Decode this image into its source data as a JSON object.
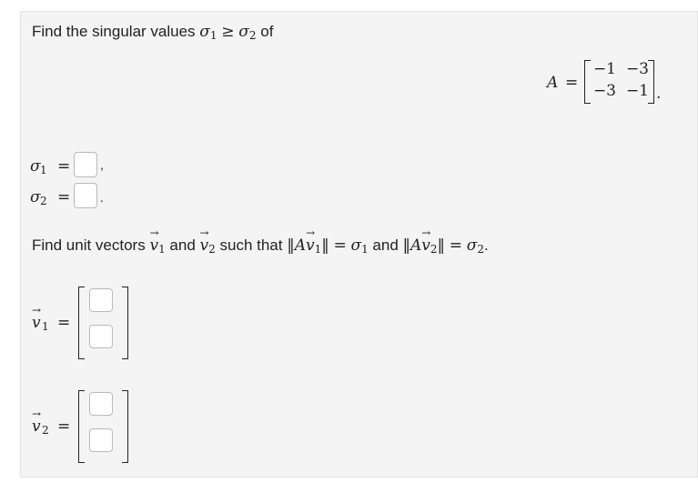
{
  "prompt_line1": {
    "text_before": "Find the singular values ",
    "sigma": "σ",
    "sub1": "1",
    "geq": "≥",
    "sub2": "2",
    "text_after": "of"
  },
  "matrix": {
    "name": "A",
    "equals": "=",
    "entries": [
      [
        "−1",
        "−3"
      ],
      [
        "−3",
        "−1"
      ]
    ],
    "trailing": "."
  },
  "sigma_answers": [
    {
      "symbol": "σ",
      "sub": "1",
      "equals": "=",
      "value": "",
      "trailing": ","
    },
    {
      "symbol": "σ",
      "sub": "2",
      "equals": "=",
      "value": "",
      "trailing": "."
    }
  ],
  "prompt_line2": {
    "text_before": "Find unit vectors ",
    "v": "v",
    "sub1": "1",
    "and1": " and ",
    "sub2": "2",
    "such_that": " such that ",
    "norm_open": "‖",
    "A": "A",
    "norm_close": "‖",
    "equals": "=",
    "sigma": "σ",
    "and2": " and ",
    "trailing": "."
  },
  "vector_answers": [
    {
      "symbol": "v",
      "sub": "1",
      "equals": "=",
      "values": [
        "",
        ""
      ]
    },
    {
      "symbol": "v",
      "sub": "2",
      "equals": "=",
      "values": [
        "",
        ""
      ]
    }
  ]
}
